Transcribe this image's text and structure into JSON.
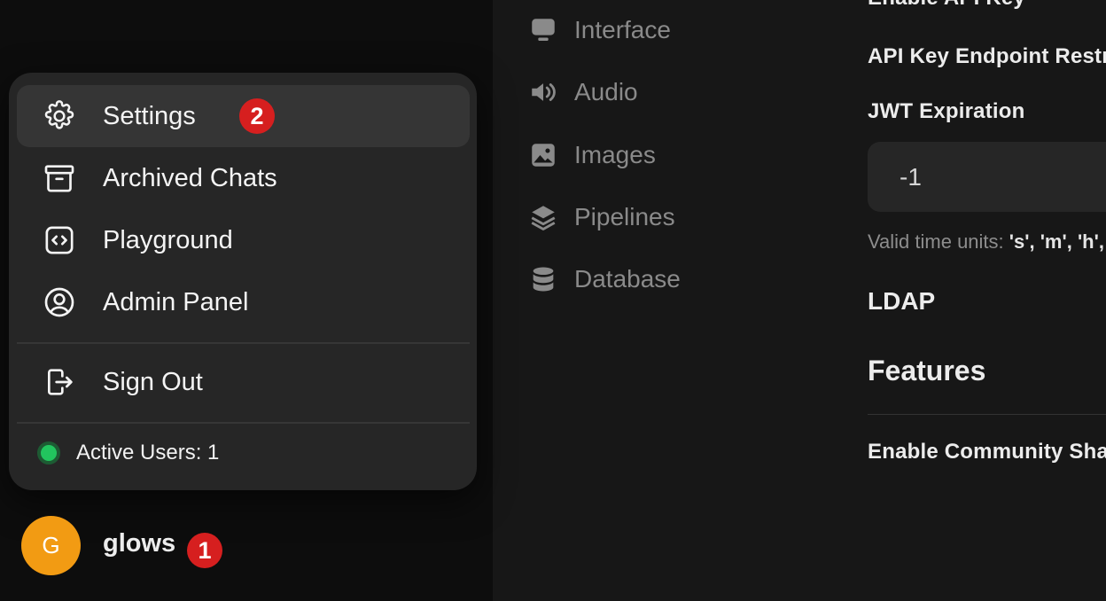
{
  "settings_nav": [
    {
      "label": "Interface",
      "icon": "monitor-icon"
    },
    {
      "label": "Audio",
      "icon": "speaker-icon"
    },
    {
      "label": "Images",
      "icon": "image-icon"
    },
    {
      "label": "Pipelines",
      "icon": "layers-icon"
    },
    {
      "label": "Database",
      "icon": "database-icon"
    }
  ],
  "content": {
    "enable_api_key": "Enable API Key",
    "api_key_endpoint": "API Key Endpoint Restrictions",
    "jwt_expiration_label": "JWT Expiration",
    "jwt_expiration_value": "-1",
    "helper_prefix": "Valid time units: ",
    "helper_units": "'s', 'm', 'h', 'd', 'w'",
    "ldap": "LDAP",
    "features": "Features",
    "enable_community_sharing": "Enable Community Sharing"
  },
  "menu": {
    "items": [
      {
        "label": "Settings",
        "icon": "gear-icon"
      },
      {
        "label": "Archived Chats",
        "icon": "archive-icon"
      },
      {
        "label": "Playground",
        "icon": "code-icon"
      },
      {
        "label": "Admin Panel",
        "icon": "user-circle-icon"
      }
    ],
    "sign_out": "Sign Out",
    "active_users": "Active Users: 1",
    "settings_badge": "2"
  },
  "user": {
    "avatar_initial": "G",
    "name": "glows",
    "badge": "1",
    "avatar_color": "#f29b13"
  },
  "colors": {
    "badge": "#d61f1f",
    "online": "#22c55e"
  }
}
